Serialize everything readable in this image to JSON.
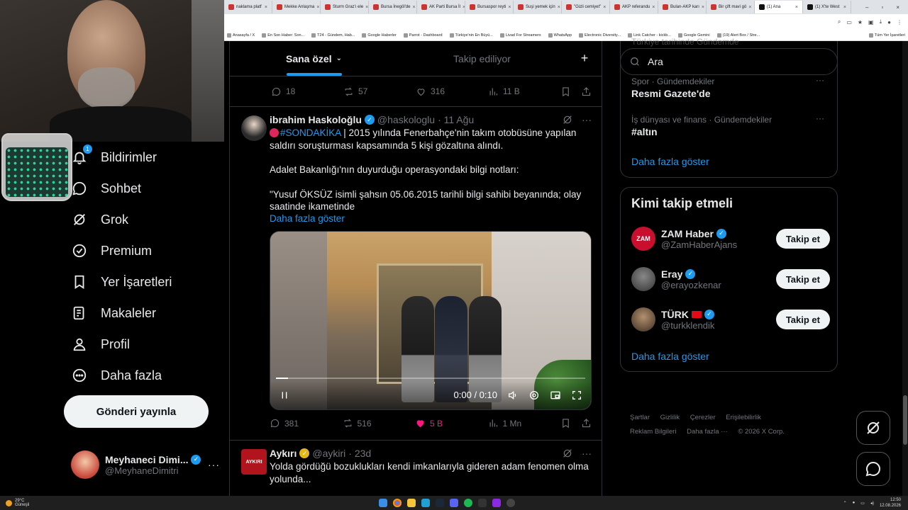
{
  "browser": {
    "tabs": [
      "naklama platf",
      "Mekke Anlaşma",
      "Sturm Graz'ı ele",
      "Bursa İnegöl'de",
      "AK Parti Bursa İl",
      "Bursaspor reyti",
      "Suşi yemek için",
      "\"Gizli cemiyet\"",
      "AKP referandu",
      "Bulan-AKP karı",
      "Bir çift mavi gö",
      "(1) Ana",
      "(1) X'te West"
    ],
    "bookmarks": [
      "Anasayfa / X",
      "En Son Haber: Son...",
      "T24 - Gündem, Hab...",
      "Google Haberler",
      "Parrot - Dashboard",
      "Türkiye'nin En Büyü...",
      "Livad For Streamers",
      "WhatsApp",
      "Electronic Diversity...",
      "Link Catcher - kickb...",
      "Google Gemini",
      "(19) Alert Box / Stre...",
      "Tüm Yer İşaretleri"
    ]
  },
  "nav": {
    "items": [
      {
        "label": "Bildirimler",
        "badge": "1"
      },
      {
        "label": "Sohbet"
      },
      {
        "label": "Grok"
      },
      {
        "label": "Premium"
      },
      {
        "label": "Yer İşaretleri"
      },
      {
        "label": "Makaleler"
      },
      {
        "label": "Profil"
      },
      {
        "label": "Daha fazla"
      }
    ],
    "post_button": "Gönderi yayınla",
    "profile": {
      "name": "Meyhaneci Dimi...",
      "handle": "@MeyhaneDimitri"
    }
  },
  "feed": {
    "tabs": [
      "Sana özel",
      "Takip ediliyor"
    ],
    "prev_stats": {
      "replies": "18",
      "reposts": "57",
      "likes": "316",
      "views": "11 B"
    },
    "tweet1": {
      "name": "ibrahim Haskoloğlu",
      "handle": "@haskologlu",
      "date": "· 11 Ağu",
      "hashtag": "#SONDAKİKA",
      "text1": " | 2015 yılında Fenerbahçe'nin takım otobüsüne yapılan saldırı soruşturması kapsamında 5 kişi gözaltına alındı.",
      "text2": "Adalet Bakanlığı'nın duyurduğu operasyondaki bilgi notları:",
      "text3": "\"Yusuf ÖKSÜZ isimli şahsın 05.06.2015 tarihli bilgi sahibi beyanında; olay saatinde ikametinde",
      "show_more": "Daha fazla göster",
      "video_time": "0:00 / 0:10",
      "video_progress": 0.04,
      "stats": {
        "replies": "381",
        "reposts": "516",
        "likes": "5 B",
        "views": "1 Mn"
      }
    },
    "tweet2": {
      "name": "Aykırı",
      "handle": "@aykiri",
      "date": "· 23d",
      "avatar_text": "AYKIRI",
      "text": "Yolda gördüğü bozuklukları kendi imkanlarıyla gideren adam fenomen olma yolunda..."
    }
  },
  "sidebar": {
    "search_placeholder": "Ara",
    "trend_cut": "Türkiye tarihinde Gündemde",
    "trends": [
      {
        "category": "Spor · Gündemdekiler",
        "title": "Resmi Gazete'de"
      },
      {
        "category": "İş dünyası ve finans · Gündemdekiler",
        "title": "#altın"
      }
    ],
    "trends_more": "Daha fazla göster",
    "who_to_follow": {
      "title": "Kimi takip etmeli",
      "users": [
        {
          "name": "ZAM Haber",
          "handle": "@ZamHaberAjans",
          "button": "Takip et",
          "avatar_text": "ZAM",
          "color": "#c8102e"
        },
        {
          "name": "Eray",
          "handle": "@erayozkenar",
          "button": "Takip et",
          "avatar_text": "",
          "color": "#444444"
        },
        {
          "name": "TÜRK",
          "handle": "@turkklendik",
          "button": "Takip et",
          "avatar_text": "",
          "color": "#5a4535"
        }
      ],
      "more": "Daha fazla göster"
    },
    "footer": [
      "Şartlar",
      "Gizlilik",
      "Çerezler",
      "Erişilebilirlik",
      "Reklam Bilgileri",
      "Daha fazla ···",
      "© 2026 X Corp."
    ]
  },
  "taskbar": {
    "weather_temp": "29°C",
    "weather_desc": "Güneşli",
    "time": "12:50",
    "date": "12.08.2026"
  },
  "colors": {
    "accent": "#1d9bf0",
    "like": "#f91880",
    "background": "#000000"
  }
}
